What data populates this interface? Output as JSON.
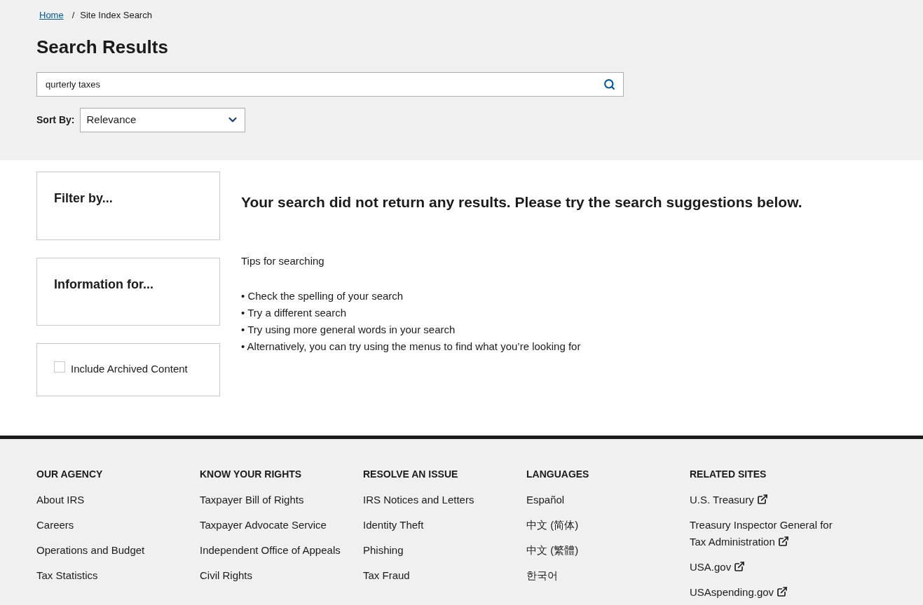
{
  "breadcrumb": [
    {
      "label": "Home",
      "kind": "link"
    },
    {
      "label": "Site Index Search",
      "kind": "current"
    }
  ],
  "breadcrumb_separator": "/",
  "title": "Search Results",
  "search": {
    "value": "qurterly taxes"
  },
  "sort": {
    "label": "Sort By:",
    "value": "Relevance"
  },
  "sidebar": {
    "filter_title": "Filter by...",
    "info_title": "Information for...",
    "archived": {
      "label": "Include Archived Content",
      "checked": false
    }
  },
  "message": "Your search did not return any results. Please try the search suggestions below.",
  "tips_title": "Tips for searching",
  "tips": [
    "• Check the spelling of your search",
    "• Try a different search",
    "• Try using more general words in your search",
    "• Alternatively, you can try using the menus to find what you’re looking for"
  ],
  "footer": [
    {
      "heading": "OUR AGENCY",
      "links": [
        {
          "label": "About IRS",
          "external": false
        },
        {
          "label": "Careers",
          "external": false
        },
        {
          "label": "Operations and Budget",
          "external": false
        },
        {
          "label": "Tax Statistics",
          "external": false
        }
      ]
    },
    {
      "heading": "KNOW YOUR RIGHTS",
      "links": [
        {
          "label": "Taxpayer Bill of Rights",
          "external": false
        },
        {
          "label": "Taxpayer Advocate Service",
          "external": false
        },
        {
          "label": "Independent Office of Appeals",
          "external": false
        },
        {
          "label": "Civil Rights",
          "external": false
        }
      ]
    },
    {
      "heading": "RESOLVE AN ISSUE",
      "links": [
        {
          "label": "IRS Notices and Letters",
          "external": false
        },
        {
          "label": "Identity Theft",
          "external": false
        },
        {
          "label": "Phishing",
          "external": false
        },
        {
          "label": "Tax Fraud",
          "external": false
        }
      ]
    },
    {
      "heading": "LANGUAGES",
      "links": [
        {
          "label": "Español",
          "external": false
        },
        {
          "label": "中文 (简体)",
          "external": false
        },
        {
          "label": "中文 (繁體)",
          "external": false
        },
        {
          "label": "한국어",
          "external": false
        }
      ]
    },
    {
      "heading": "RELATED SITES",
      "links": [
        {
          "label": "U.S. Treasury",
          "external": true
        },
        {
          "label": "Treasury Inspector General for Tax Administration",
          "external": true
        },
        {
          "label": "USA.gov",
          "external": true
        },
        {
          "label": "USAspending.gov",
          "external": true
        }
      ]
    }
  ]
}
